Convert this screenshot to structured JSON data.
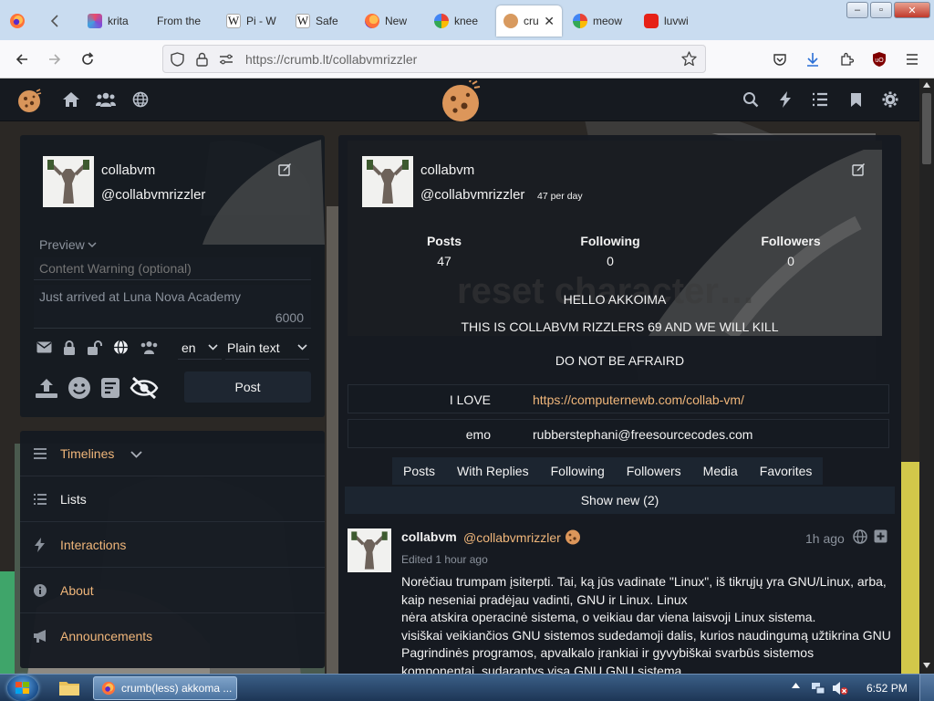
{
  "browser": {
    "tabs": [
      {
        "label": "krita",
        "active": false
      },
      {
        "label": "From the",
        "active": false
      },
      {
        "label": "Pi - W",
        "active": false
      },
      {
        "label": "Safe",
        "active": false
      },
      {
        "label": "New",
        "active": false
      },
      {
        "label": "knee",
        "active": false
      },
      {
        "label": "cru",
        "active": true
      },
      {
        "label": "meow",
        "active": false
      },
      {
        "label": "luvwi",
        "active": false
      }
    ],
    "url": "https://crumb.lt/collabvmrizzler",
    "window_buttons": {
      "minimize": "–",
      "maximize": "▫",
      "close": "✕"
    }
  },
  "site": {
    "nav_icons": [
      "home-icon",
      "people-icon",
      "globe-icon",
      "search-icon",
      "bolt-icon",
      "list-icon",
      "bookmark-icon",
      "gear-icon"
    ]
  },
  "composer": {
    "display_name": "collabvm",
    "handle": "@collabvmrizzler",
    "preview_label": "Preview",
    "cw_placeholder": "Content Warning (optional)",
    "body_placeholder": "Just arrived at Luna Nova Academy",
    "char_count": "6000",
    "language": "en",
    "format": "Plain text",
    "post_button": "Post"
  },
  "sidebar_nav": {
    "items": [
      {
        "label": "Timelines",
        "icon": "bars-icon",
        "highlight": true
      },
      {
        "label": "Lists",
        "icon": "list-icon",
        "highlight": false
      },
      {
        "label": "Interactions",
        "icon": "bolt-icon",
        "highlight": true
      },
      {
        "label": "About",
        "icon": "info-icon",
        "highlight": true
      },
      {
        "label": "Announcements",
        "icon": "megaphone-icon",
        "highlight": true
      }
    ]
  },
  "profile": {
    "display_name": "collabvm",
    "handle": "@collabvmrizzler",
    "rate": "47 per day",
    "stats": {
      "posts_label": "Posts",
      "posts": "47",
      "following_label": "Following",
      "following": "0",
      "followers_label": "Followers",
      "followers": "0"
    },
    "bio": [
      "HELLO AKKOIMA",
      "THIS IS COLLABVM RIZZLERS 69 AND WE WILL KILL",
      "DO NOT BE AFRAIRD"
    ],
    "fields": [
      {
        "name": "I LOVE",
        "value": "https://computernewb.com/collab-vm/",
        "link": true
      },
      {
        "name": "emo",
        "value": "rubberstephani@freesourcecodes.com",
        "link": false
      }
    ],
    "tabs": [
      "Posts",
      "With Replies",
      "Following",
      "Followers",
      "Media",
      "Favorites"
    ],
    "show_new": "Show new (2)"
  },
  "post": {
    "display_name": "collabvm",
    "handle": "@collabvmrizzler",
    "time": "1h ago",
    "edited": "Edited 1 hour ago",
    "lines": [
      "Norėčiau trumpam įsiterpti. Tai, ką jūs vadinate \"Linux\", iš tikrųjų yra GNU/Linux, arba,",
      "kaip neseniai pradėjau vadinti, GNU ir Linux. Linux",
      "nėra atskira operacinė sistema, o veikiau dar viena laisvoji Linux sistema.",
      "visiškai veikiančios GNU sistemos sudedamoji dalis, kurios naudingumą užtikrina GNU",
      "Pagrindinės programos, apvalkalo įrankiai ir gyvybiškai svarbūs sistemos",
      "komponentai, sudarantys visą GNU GNU sistema."
    ]
  },
  "taskbar": {
    "task_label": "crumb(less) akkoma ...",
    "clock": "6:52 PM"
  }
}
